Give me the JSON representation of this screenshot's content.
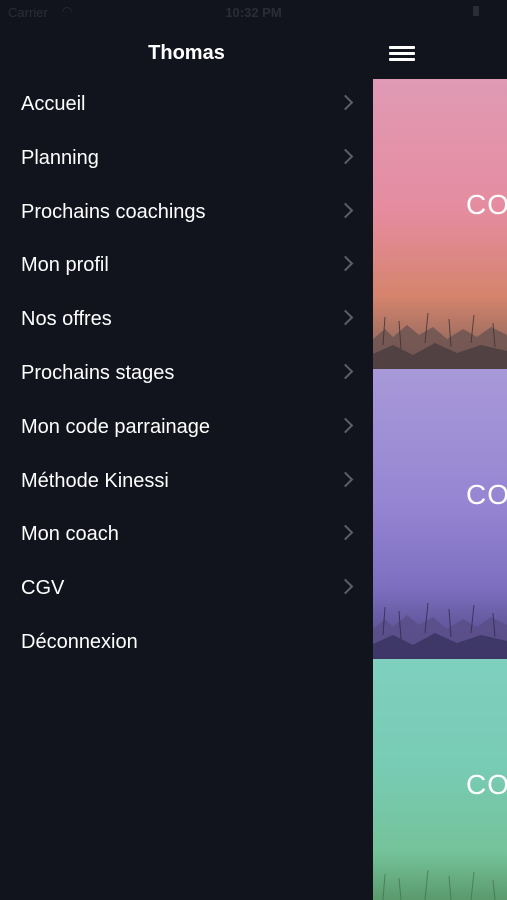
{
  "status_bar": {
    "carrier": "Carrier",
    "time": "10:32 PM"
  },
  "header": {
    "user_name": "Thomas"
  },
  "menu": {
    "items": [
      {
        "label": "Accueil",
        "has_chevron": true
      },
      {
        "label": "Planning",
        "has_chevron": true
      },
      {
        "label": "Prochains coachings",
        "has_chevron": true
      },
      {
        "label": "Mon profil",
        "has_chevron": true
      },
      {
        "label": "Nos offres",
        "has_chevron": true
      },
      {
        "label": "Prochains stages",
        "has_chevron": true
      },
      {
        "label": "Mon code parrainage",
        "has_chevron": true
      },
      {
        "label": "Méthode Kinessi",
        "has_chevron": true
      },
      {
        "label": "Mon coach",
        "has_chevron": true
      },
      {
        "label": "CGV",
        "has_chevron": true
      },
      {
        "label": "Déconnexion",
        "has_chevron": false
      }
    ]
  },
  "cards": [
    {
      "title": "CO",
      "color": "#e58ca0"
    },
    {
      "title": "CO",
      "color": "#9686d3"
    },
    {
      "title": "CO",
      "color": "#78cbb4"
    }
  ],
  "colors": {
    "background": "#12141d",
    "text": "#ffffff",
    "chevron": "#5b5f6b"
  }
}
